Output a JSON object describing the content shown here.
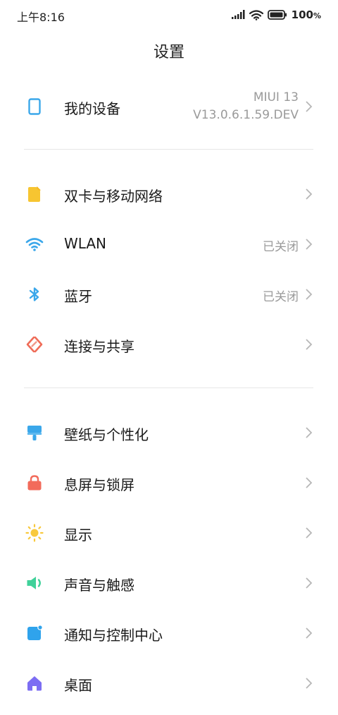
{
  "status_bar": {
    "time": "上午8:16",
    "battery_text": "100",
    "battery_unit": "%"
  },
  "header": {
    "title": "设置"
  },
  "device": {
    "label": "我的设备",
    "os_name": "MIUI 13",
    "version": "V13.0.6.1.59.DEV",
    "icon": "phone-outline-icon"
  },
  "network_group": [
    {
      "label": "双卡与移动网络",
      "value": "",
      "icon": "sim-card-icon"
    },
    {
      "label": "WLAN",
      "value": "已关闭",
      "icon": "wifi-icon"
    },
    {
      "label": "蓝牙",
      "value": "已关闭",
      "icon": "bluetooth-icon"
    },
    {
      "label": "连接与共享",
      "value": "",
      "icon": "share-connection-icon"
    }
  ],
  "personal_group": [
    {
      "label": "壁纸与个性化",
      "icon": "paint-roller-icon"
    },
    {
      "label": "息屏与锁屏",
      "icon": "lock-icon"
    },
    {
      "label": "显示",
      "icon": "sun-icon"
    },
    {
      "label": "声音与触感",
      "icon": "speaker-icon"
    },
    {
      "label": "通知与控制中心",
      "icon": "notification-icon"
    },
    {
      "label": "桌面",
      "icon": "home-icon"
    }
  ],
  "colors": {
    "sim": "#f7c531",
    "wifi": "#3aa7ea",
    "bluetooth": "#3aa7ea",
    "share": "#ef6c58",
    "wallpaper": "#3aa7ea",
    "lock": "#f26b5b",
    "display": "#f8c93d",
    "sound": "#40d19a",
    "notification": "#2fa3ec",
    "home": "#7c6df3",
    "chevron": "#b7b7b7",
    "secondary_text": "#9a9a9a"
  }
}
